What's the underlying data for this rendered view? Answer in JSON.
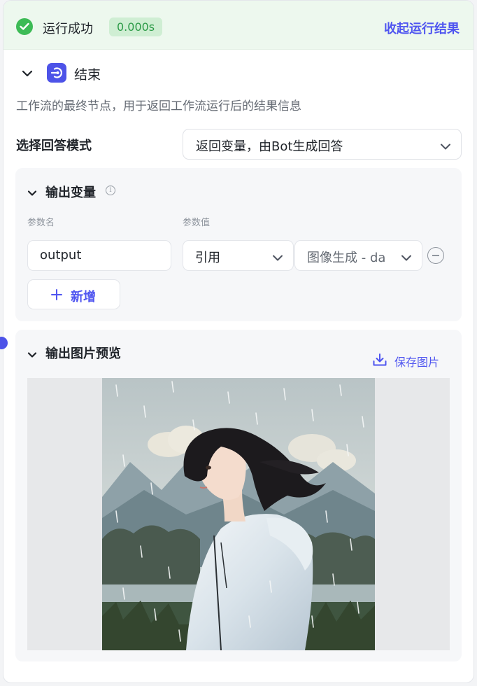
{
  "status": {
    "text": "运行成功",
    "duration": "0.000s",
    "collapse_label": "收起运行结果",
    "color": "#3dbb56"
  },
  "node": {
    "title": "结束",
    "description": "工作流的最终节点，用于返回工作流运行后的结果信息",
    "accent": "#4d53e8"
  },
  "answer_mode": {
    "label": "选择回答模式",
    "value": "返回变量，由Bot生成回答"
  },
  "output_vars": {
    "title": "输出变量",
    "col_name": "参数名",
    "col_value": "参数值",
    "rows": [
      {
        "name": "output",
        "ref_type": "引用",
        "ref_value": "图像生成 - da"
      }
    ],
    "add_label": "新增"
  },
  "image_preview": {
    "title": "输出图片预览",
    "save_label": "保存图片"
  },
  "icons": [
    "check-circle-icon",
    "chevron-down-icon",
    "end-node-icon",
    "info-icon",
    "plus-icon",
    "minus-circle-icon",
    "download-icon"
  ]
}
